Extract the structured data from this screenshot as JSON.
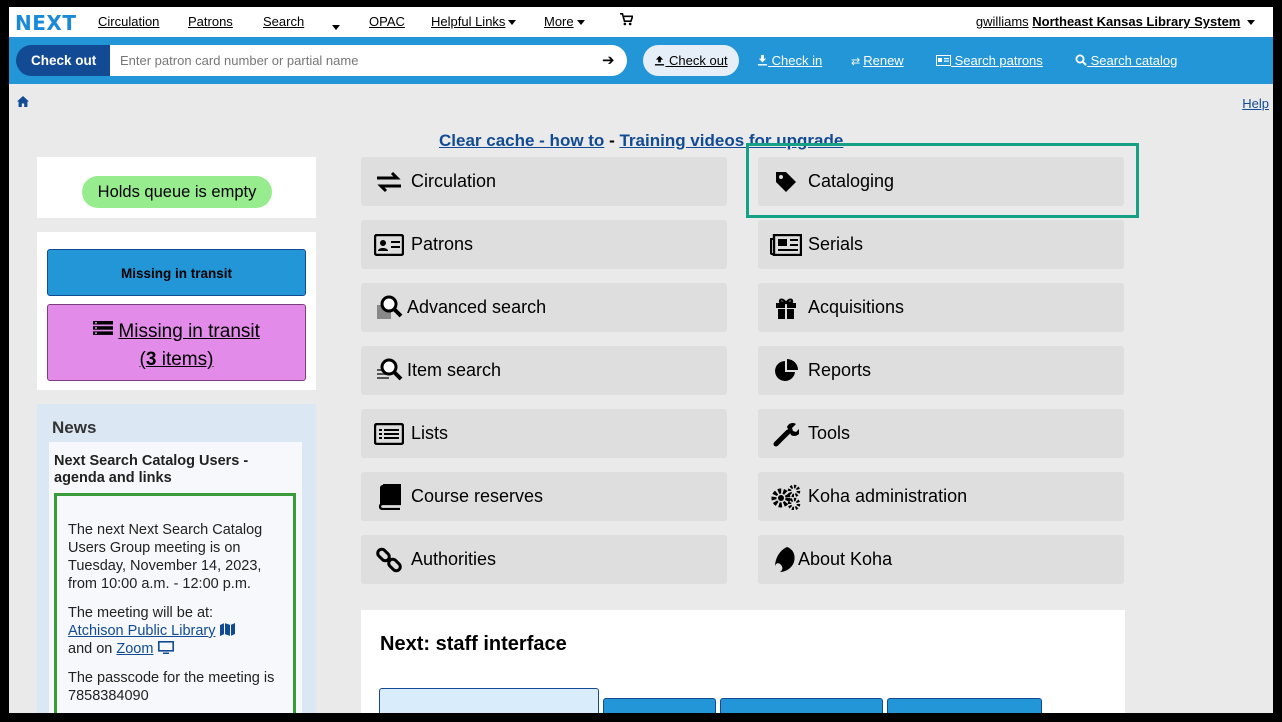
{
  "topnav": {
    "logo": "NEXT",
    "links": [
      "Circulation",
      "Patrons",
      "Search",
      "OPAC",
      "Helpful Links",
      "More"
    ],
    "user": "gwilliams",
    "library": "Northeast Kansas Library System"
  },
  "searchbar": {
    "mode_label": "Check out",
    "placeholder": "Enter patron card number or partial name",
    "actions": [
      "Check out",
      "Check in",
      "Renew",
      "Search patrons",
      "Search catalog"
    ]
  },
  "help_label": "Help",
  "banner": {
    "link1": "Clear cache - how to",
    "separator": "-",
    "link2": "Training videos for upgrade"
  },
  "holds": {
    "label": "Holds queue is empty"
  },
  "transit": {
    "button_label": "Missing in transit",
    "items_label": "Missing in transit",
    "items_count": "3",
    "items_suffix": "items)"
  },
  "news": {
    "title": "News",
    "headline": "Next Search Catalog Users - agenda and links",
    "para1": "The next Next Search Catalog Users Group meeting is on Tuesday, November 14, 2023, from 10:00 a.m. - 12:00 p.m.",
    "para2_prefix": "The meeting will be at:",
    "location_link": "Atchison Public Library",
    "para2_mid": "and on",
    "zoom_link": "Zoom",
    "para3": "The passcode for the meeting is 7858384090"
  },
  "tiles": {
    "circulation": "Circulation",
    "cataloging": "Cataloging",
    "patrons": "Patrons",
    "serials": "Serials",
    "advanced_search": "Advanced search",
    "acquisitions": "Acquisitions",
    "item_search": "Item search",
    "reports": "Reports",
    "lists": "Lists",
    "tools": "Tools",
    "course_reserves": "Course reserves",
    "koha_admin": "Koha administration",
    "authorities": "Authorities",
    "about_koha": "About Koha"
  },
  "staff_panel": {
    "title": "Next: staff interface"
  },
  "colors": {
    "primary": "#2396d8",
    "dark": "#124b93",
    "highlight": "#16a085",
    "holds": "#97ec8e",
    "transit_items": "#e38be8"
  }
}
